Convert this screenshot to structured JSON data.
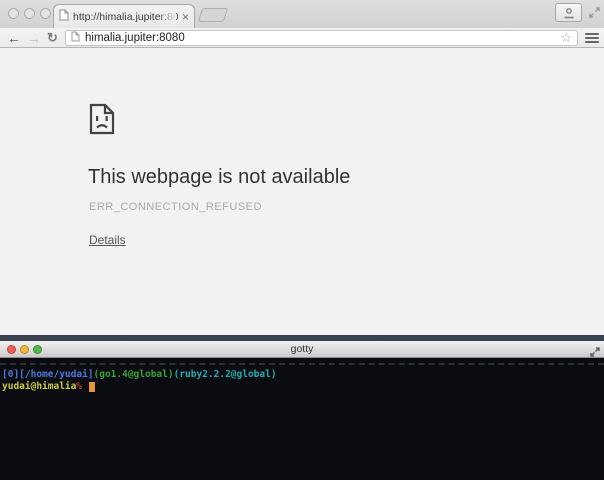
{
  "browser": {
    "window_controls": {
      "inactive_color": "#e2e2e2"
    },
    "tab": {
      "title": "http://himalia.jupiter:808",
      "close_glyph": "×"
    },
    "toolbar": {
      "back_glyph": "←",
      "forward_glyph": "→",
      "reload_glyph": "↻",
      "url": "himalia.jupiter:8080",
      "star_glyph": "☆"
    },
    "error_page": {
      "title": "This webpage is not available",
      "error_code": "ERR_CONNECTION_REFUSED",
      "details_label": "Details"
    }
  },
  "terminal": {
    "title": "gotty",
    "background": "#0b0c11",
    "traffic_lights": {
      "close": "#f25d54",
      "minimize": "#f6b73e",
      "zoom": "#53b948"
    },
    "prompt_line1": [
      {
        "text": "[0][/home/yudai]",
        "color": "#4f7ad8"
      },
      {
        "text": "(go1.4@global)",
        "color": "#35a435"
      },
      {
        "text": "(ruby2.2.2@global)",
        "color": "#25aeae"
      }
    ],
    "prompt_line2": {
      "user_host": {
        "text": "yudai@himalia",
        "color": "#c9cf3a"
      },
      "symbol": {
        "text": "%",
        "color": "#c0392b"
      },
      "cursor_color": "#e8953a"
    }
  }
}
